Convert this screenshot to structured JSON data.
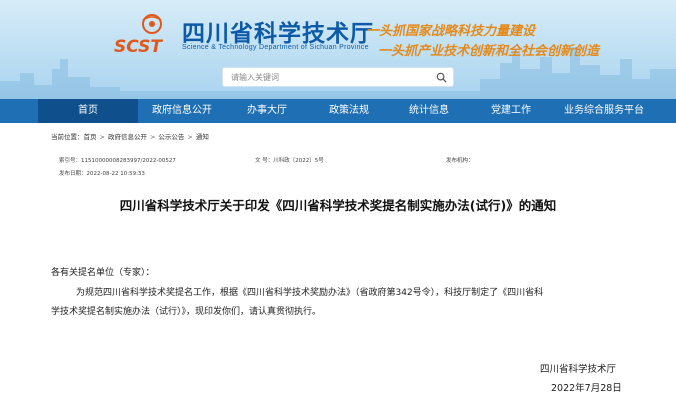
{
  "header": {
    "site_title": "四川省科学技术厅",
    "site_subtitle": "Science & Technology Department of Sichuan Province",
    "logo_text": "SCST",
    "slogan_1": "一头抓国家战略科技力量建设",
    "slogan_2": "一头抓产业技术创新和全社会创新创造"
  },
  "search": {
    "placeholder": "请输入关键词"
  },
  "nav": {
    "items": [
      {
        "label": "首页"
      },
      {
        "label": "政府信息公开"
      },
      {
        "label": "办事大厅"
      },
      {
        "label": "政策法规"
      },
      {
        "label": "统计信息"
      },
      {
        "label": "党建工作"
      },
      {
        "label": "业务综合服务平台"
      }
    ]
  },
  "breadcrumb": {
    "prefix": "当前位置：",
    "items": [
      "首页",
      "政府信息公开",
      "公示公告",
      "通知"
    ]
  },
  "meta": {
    "index_label": "索引号：",
    "index_value": "11510000008283997/2022-00527",
    "doc_no_label": "文  号：",
    "doc_no_value": "川科政〔2022〕5号",
    "publisher_label": "发布机构：",
    "date_label": "发布日期：",
    "date_value": "2022-08-22 10:59:33"
  },
  "document": {
    "title": "四川省科学技术厅关于印发《四川省科学技术奖提名制实施办法(试行)》的通知",
    "salutation": "各有关提名单位（专家）：",
    "para_line1": "为规范四川省科学技术奖提名工作，根据《四川省科学技术奖励办法》（省政府第342号令），科技厅制定了《四川省科",
    "para_line2": "学技术奖提名制实施办法（试行）》，现印发你们，请认真贯彻执行。",
    "signature": "四川省科学技术厅",
    "sign_date": "2022年7月28日"
  },
  "colors": {
    "nav_bg": "#1e6fb4",
    "nav_active": "#0f4f8c",
    "brand_blue": "#0d5ba8",
    "slogan_orange": "#e58a1a"
  }
}
